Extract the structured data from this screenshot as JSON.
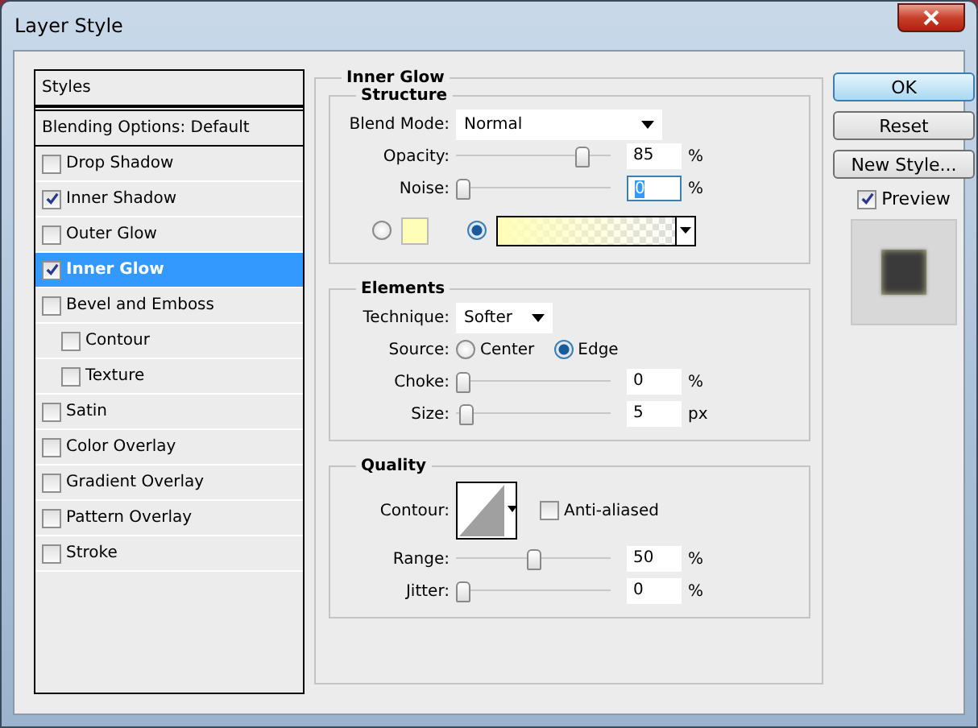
{
  "window": {
    "title": "Layer Style"
  },
  "styles_list": {
    "header": "Styles",
    "blending": "Blending Options: Default",
    "items": [
      {
        "label": "Drop Shadow",
        "checked": false,
        "selected": false
      },
      {
        "label": "Inner Shadow",
        "checked": true,
        "selected": false
      },
      {
        "label": "Outer Glow",
        "checked": false,
        "selected": false
      },
      {
        "label": "Inner Glow",
        "checked": true,
        "selected": true
      },
      {
        "label": "Bevel and Emboss",
        "checked": false,
        "selected": false,
        "children": [
          {
            "label": "Contour",
            "checked": false,
            "selected": false
          },
          {
            "label": "Texture",
            "checked": false,
            "selected": false
          }
        ]
      },
      {
        "label": "Satin",
        "checked": false,
        "selected": false
      },
      {
        "label": "Color Overlay",
        "checked": false,
        "selected": false
      },
      {
        "label": "Gradient Overlay",
        "checked": false,
        "selected": false
      },
      {
        "label": "Pattern Overlay",
        "checked": false,
        "selected": false
      },
      {
        "label": "Stroke",
        "checked": false,
        "selected": false
      }
    ]
  },
  "panel": {
    "title": "Inner Glow",
    "structure": {
      "title": "Structure",
      "blend_mode": {
        "label": "Blend Mode:",
        "value": "Normal"
      },
      "sliders": [
        {
          "label": "Opacity:",
          "level": 0.85,
          "value": "85",
          "unit": "%",
          "focused": false
        },
        {
          "label": "Noise:",
          "level": 0,
          "value": "0",
          "unit": "%",
          "focused": true
        }
      ],
      "fill": [
        {
          "kind": "color",
          "selected": false
        },
        {
          "kind": "gradient",
          "selected": true
        }
      ]
    },
    "elements": {
      "title": "Elements",
      "technique": {
        "label": "Technique:",
        "value": "Softer"
      },
      "source": {
        "label": "Source:",
        "options": [
          {
            "label": "Center",
            "selected": false
          },
          {
            "label": "Edge",
            "selected": true
          }
        ]
      },
      "sliders": [
        {
          "label": "Choke:",
          "level": 0,
          "value": "0",
          "unit": "%",
          "focused": false
        },
        {
          "label": "Size:",
          "level": 0.02,
          "value": "5",
          "unit": "px",
          "focused": false
        }
      ]
    },
    "quality": {
      "title": "Quality",
      "contour_label": "Contour:",
      "anti_aliased": {
        "label": "Anti-aliased",
        "checked": false
      },
      "sliders": [
        {
          "label": "Range:",
          "level": 0.5,
          "value": "50",
          "unit": "%",
          "focused": false
        },
        {
          "label": "Jitter:",
          "level": 0,
          "value": "0",
          "unit": "%",
          "focused": false
        }
      ]
    }
  },
  "buttons": [
    {
      "label": "OK",
      "default": true
    },
    {
      "label": "Reset",
      "default": false
    },
    {
      "label": "New Style...",
      "default": false
    }
  ],
  "preview": {
    "label": "Preview",
    "checked": true
  }
}
